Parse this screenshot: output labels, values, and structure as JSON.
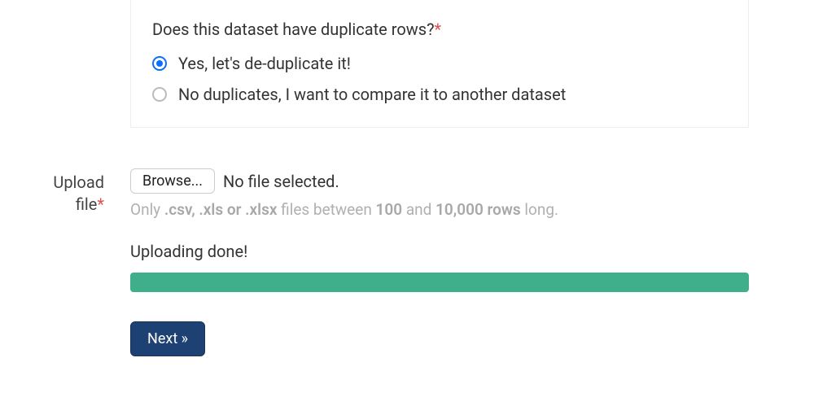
{
  "question": {
    "text": "Does this dataset have duplicate rows?",
    "required_mark": "*",
    "options": [
      {
        "label": "Yes, let's de-duplicate it!",
        "selected": true
      },
      {
        "label": "No duplicates, I want to compare it to another dataset",
        "selected": false
      }
    ]
  },
  "upload": {
    "label_line1": "Upload",
    "label_line2": "file",
    "required_mark": "*",
    "browse_label": "Browse...",
    "file_status": "No file selected.",
    "hint_prefix": "Only ",
    "hint_formats": ".csv, .xls or .xlsx",
    "hint_mid1": " files between ",
    "hint_min": "100",
    "hint_mid2": " and ",
    "hint_max": "10,000 rows",
    "hint_suffix": " long.",
    "status": "Uploading done!",
    "progress_percent": 100
  },
  "next_label": "Next »"
}
